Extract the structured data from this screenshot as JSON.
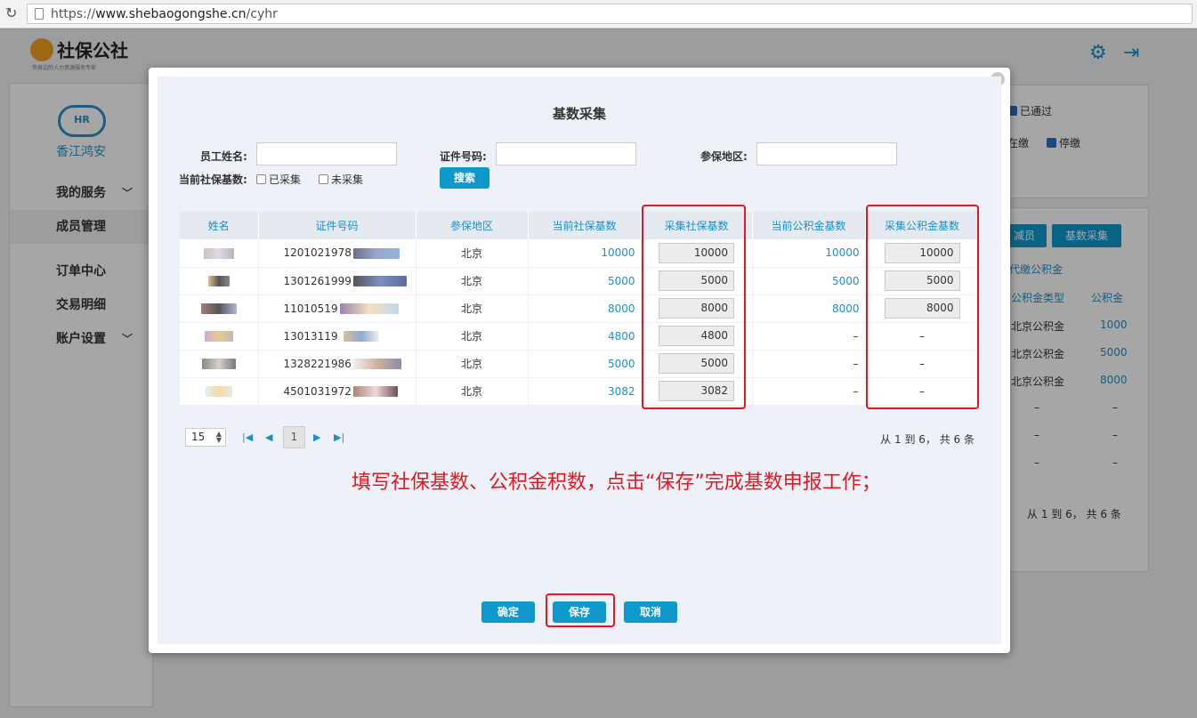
{
  "browser": {
    "url_prefix": "https://",
    "url_host": "www.shebaogongshe.cn",
    "url_path": "/cyhr"
  },
  "app": {
    "logo_text": "社保公社",
    "logo_tagline": "你身边的人力资源服务专家",
    "company_name": "香江鸿安",
    "hr_logo": "HR",
    "nav": [
      {
        "label": "我的服务"
      },
      {
        "label": "成员管理"
      },
      {
        "label": "订单中心"
      },
      {
        "label": "交易明细"
      },
      {
        "label": "账户设置"
      }
    ],
    "right_panel": {
      "passed": "已通过",
      "paid_partial": "在缴",
      "stopped": "停缴",
      "btn_reduce": "减员",
      "btn_base": "基数采集",
      "tab_fund": "代缴公积金",
      "col_fund_type": "公积金类型",
      "col_fund": "公积金",
      "rows": [
        {
          "type": "北京公积金",
          "val": "1000"
        },
        {
          "type": "北京公积金",
          "val": "5000"
        },
        {
          "type": "北京公积金",
          "val": "8000"
        },
        {
          "type": "–",
          "val": "–"
        },
        {
          "type": "–",
          "val": "–"
        },
        {
          "type": "–",
          "val": "–"
        }
      ],
      "info": "从 1 到 6， 共 6 条"
    }
  },
  "modal": {
    "title": "基数采集",
    "close": "×",
    "filters": {
      "name_label": "员工姓名:",
      "id_label": "证件号码:",
      "region_label": "参保地区:",
      "base_label": "当前社保基数:",
      "collected": "已采集",
      "not_collected": "未采集",
      "search": "搜索"
    },
    "table": {
      "headers": [
        "姓名",
        "证件号码",
        "参保地区",
        "当前社保基数",
        "采集社保基数",
        "当前公积金基数",
        "采集公积金基数"
      ],
      "rows": [
        {
          "id": "1201021978",
          "region": "北京",
          "cur_si": "10000",
          "col_si": "10000",
          "cur_hf": "10000",
          "col_hf": "10000"
        },
        {
          "id": "1301261999",
          "region": "北京",
          "cur_si": "5000",
          "col_si": "5000",
          "cur_hf": "5000",
          "col_hf": "5000"
        },
        {
          "id": "11010519",
          "region": "北京",
          "cur_si": "8000",
          "col_si": "8000",
          "cur_hf": "8000",
          "col_hf": "8000"
        },
        {
          "id": "13013119",
          "region": "北京",
          "cur_si": "4800",
          "col_si": "4800",
          "cur_hf": "–",
          "col_hf": "–"
        },
        {
          "id": "1328221986",
          "region": "北京",
          "cur_si": "5000",
          "col_si": "5000",
          "cur_hf": "–",
          "col_hf": "–"
        },
        {
          "id": "4501031972",
          "region": "北京",
          "cur_si": "3082",
          "col_si": "3082",
          "cur_hf": "–",
          "col_hf": "–"
        }
      ]
    },
    "pager": {
      "page_size": "15",
      "current": "1",
      "info": "从 1 到 6， 共 6 条"
    },
    "annotation": "填写社保基数、公积金积数，点击“保存”完成基数申报工作；",
    "buttons": {
      "confirm": "确定",
      "save": "保存",
      "cancel": "取消"
    }
  },
  "colors": {
    "accent": "#0e98cc",
    "link": "#1f8fc5",
    "highlight": "#e5161f"
  }
}
